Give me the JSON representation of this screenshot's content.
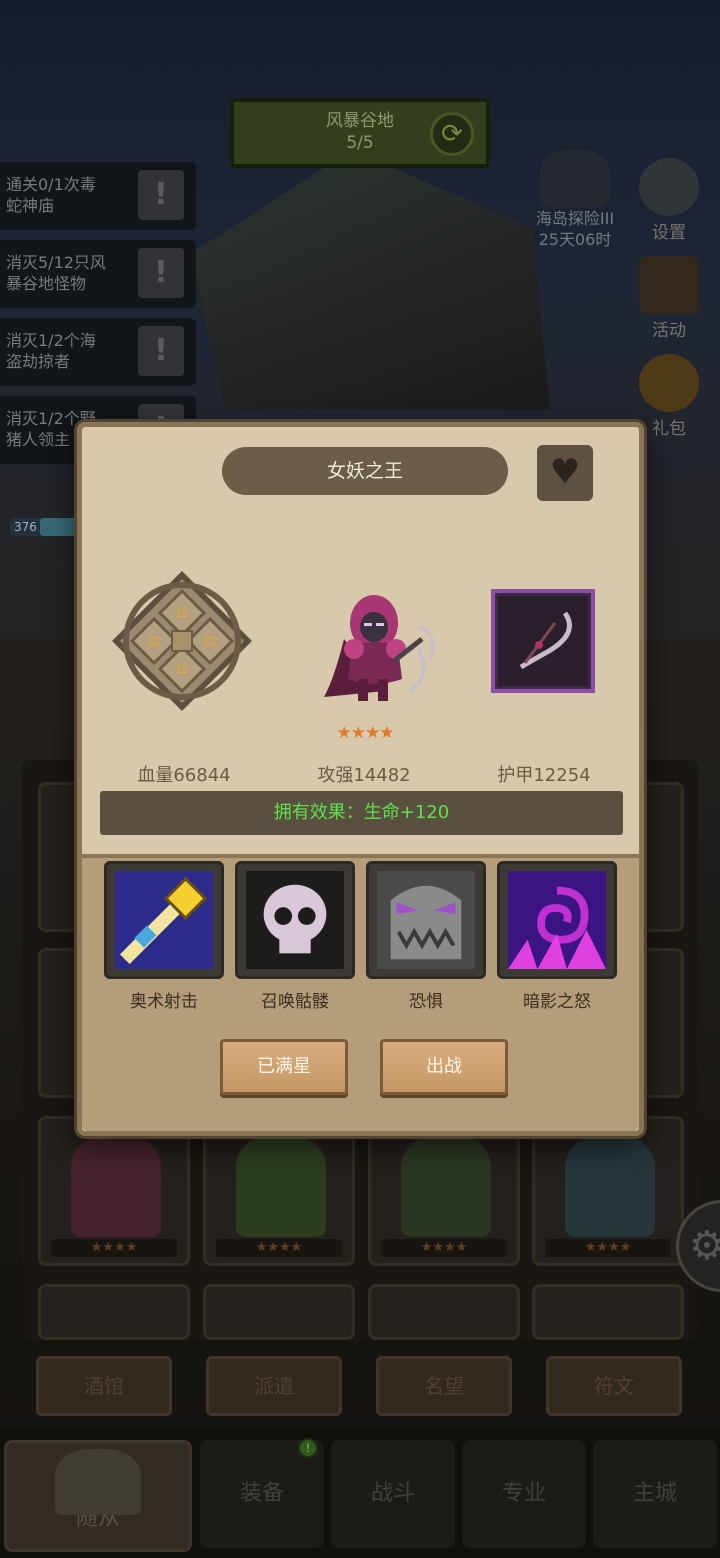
{
  "top_banner": {
    "title": "风暴谷地",
    "progress": "5/5"
  },
  "quests": [
    {
      "line1": "通关0/1次毒",
      "line2": "蛇神庙"
    },
    {
      "line1": "消灭5/12只风",
      "line2": "暴谷地怪物"
    },
    {
      "line1": "消灭1/2个海",
      "line2": "盗劫掠者"
    },
    {
      "line1": "消灭1/2个野",
      "line2": "猪人领主"
    }
  ],
  "sea_event": {
    "name": "海岛探险III",
    "timer": "25天06时"
  },
  "side_menu": {
    "settings": "设置",
    "activity": "活动",
    "gift": "礼包"
  },
  "level_tag": "376",
  "hero": {
    "name": "女妖之王",
    "stars": "★★★★",
    "hp_label": "血量66844",
    "attack_label": "攻强14482",
    "armor_label": "护甲12254",
    "owned_effect": "拥有效果：生命+120"
  },
  "skills": [
    {
      "name": "奥术射击",
      "icon": "arcane-shot-icon"
    },
    {
      "name": "召唤骷髅",
      "icon": "skull-icon"
    },
    {
      "name": "恐惧",
      "icon": "fear-mask-icon"
    },
    {
      "name": "暗影之怒",
      "icon": "shadow-fury-icon"
    }
  ],
  "buttons": {
    "max_star": "已满星",
    "deploy": "出战"
  },
  "card_stars": "★★★★",
  "tabs": [
    "酒馆",
    "派遣",
    "名望",
    "符文"
  ],
  "bottom_nav": {
    "followers": "随从",
    "equipment": "装备",
    "battle": "战斗",
    "profession": "专业",
    "city": "主城"
  },
  "colors": {
    "effect_text": "#5fe24a",
    "star": "#e07a2c",
    "weapon_frame": "#8a4fa6"
  }
}
